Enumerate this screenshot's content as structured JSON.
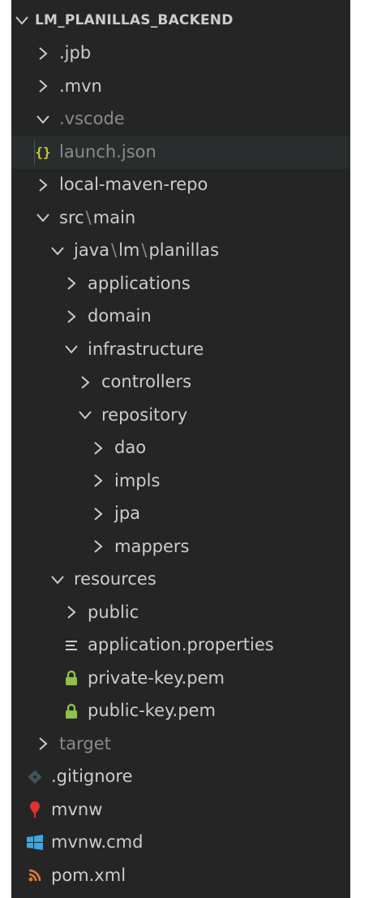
{
  "explorer": {
    "root": {
      "label": "LM_PLANILLAS_BACKEND",
      "expanded": true
    },
    "items": [
      {
        "label": ".jpb",
        "kind": "folder",
        "expanded": false
      },
      {
        "label": ".mvn",
        "kind": "folder",
        "expanded": false
      },
      {
        "label": ".vscode",
        "kind": "folder",
        "expanded": true,
        "dimmed": true
      },
      {
        "label": "launch.json",
        "kind": "file",
        "icon": "json-icon",
        "dimmed": true,
        "selected": true
      },
      {
        "label": "local-maven-repo",
        "kind": "folder",
        "expanded": false
      },
      {
        "label": "src",
        "kind": "folder",
        "expanded": true,
        "compact_parts": [
          "src",
          "main"
        ]
      },
      {
        "label": "java",
        "kind": "folder",
        "expanded": true,
        "compact_parts": [
          "java",
          "lm",
          "planillas"
        ]
      },
      {
        "label": "applications",
        "kind": "folder",
        "expanded": false
      },
      {
        "label": "domain",
        "kind": "folder",
        "expanded": false
      },
      {
        "label": "infrastructure",
        "kind": "folder",
        "expanded": true
      },
      {
        "label": "controllers",
        "kind": "folder",
        "expanded": false
      },
      {
        "label": "repository",
        "kind": "folder",
        "expanded": true
      },
      {
        "label": "dao",
        "kind": "folder",
        "expanded": false
      },
      {
        "label": "impls",
        "kind": "folder",
        "expanded": false
      },
      {
        "label": "jpa",
        "kind": "folder",
        "expanded": false
      },
      {
        "label": "mappers",
        "kind": "folder",
        "expanded": false
      },
      {
        "label": "resources",
        "kind": "folder",
        "expanded": true
      },
      {
        "label": "public",
        "kind": "folder",
        "expanded": false
      },
      {
        "label": "application.properties",
        "kind": "file",
        "icon": "properties-icon"
      },
      {
        "label": "private-key.pem",
        "kind": "file",
        "icon": "lock-icon"
      },
      {
        "label": "public-key.pem",
        "kind": "file",
        "icon": "lock-icon"
      },
      {
        "label": "target",
        "kind": "folder",
        "expanded": false,
        "dimmed": true
      },
      {
        "label": ".gitignore",
        "kind": "file",
        "icon": "git-icon"
      },
      {
        "label": "mvnw",
        "kind": "file",
        "icon": "pin-icon"
      },
      {
        "label": "mvnw.cmd",
        "kind": "file",
        "icon": "windows-icon"
      },
      {
        "label": "pom.xml",
        "kind": "file",
        "icon": "rss-icon"
      }
    ]
  },
  "colors": {
    "panel": "#252526",
    "text": "#cccccc",
    "dimmed_text": "#8a8a8a",
    "json_icon": "#cbcb41",
    "lock_icon": "#8dc149",
    "git_icon": "#41535b",
    "pin_icon": "#e03232",
    "windows_icon": "#3ea6e0",
    "rss_icon": "#e37933"
  }
}
